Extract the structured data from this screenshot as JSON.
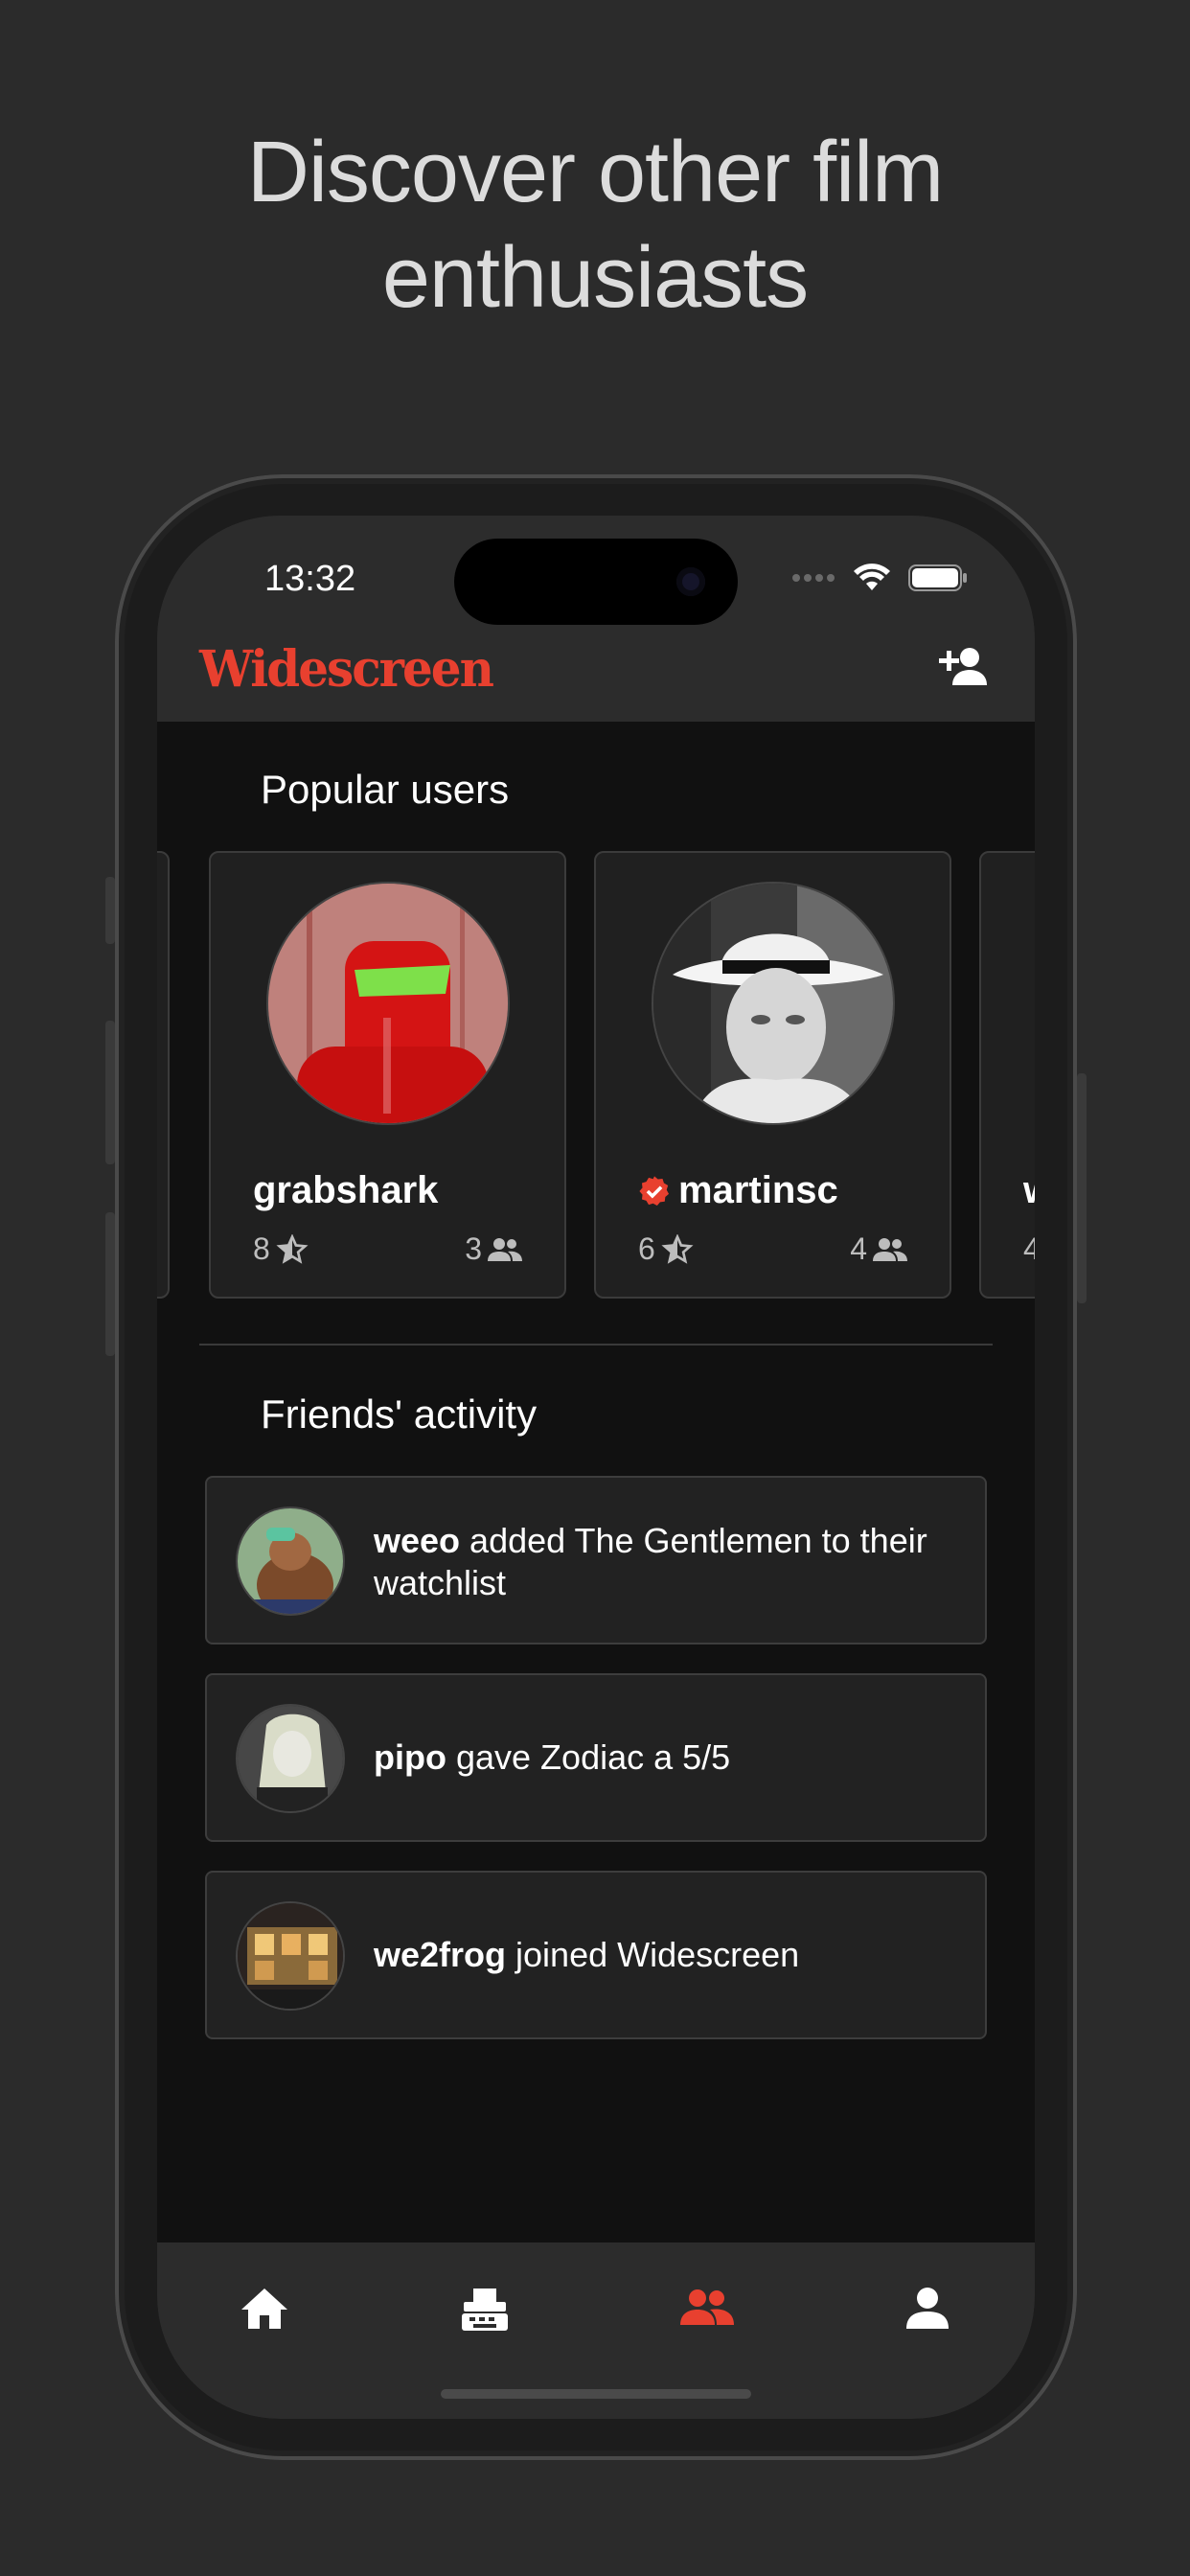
{
  "headline": {
    "line1": "Discover other film",
    "line2": "enthusiasts"
  },
  "status_bar": {
    "time": "13:32"
  },
  "app": {
    "brand": "Widescreen"
  },
  "popular": {
    "title": "Popular users",
    "users": [
      {
        "name": "grabshark",
        "ratings": "8",
        "friends": "3",
        "verified": false
      },
      {
        "name": "martinsc",
        "ratings": "6",
        "friends": "4",
        "verified": true
      }
    ],
    "peek_next": {
      "name_initial": "w",
      "ratings": "4"
    }
  },
  "activity": {
    "title": "Friends' activity",
    "items": [
      {
        "user": "weeo",
        "text": " added The Gentlemen to their watchlist"
      },
      {
        "user": "pipo",
        "text": " gave Zodiac a 5/5"
      },
      {
        "user": "we2frog",
        "text": " joined Widescreen"
      }
    ]
  },
  "colors": {
    "accent": "#e8402f",
    "background": "#2b2b2b",
    "screen_bg": "#111111",
    "bar_bg": "#2c2c2c"
  },
  "tabs": [
    {
      "icon": "home-icon",
      "active": false
    },
    {
      "icon": "typewriter-icon",
      "active": false
    },
    {
      "icon": "people-icon",
      "active": true
    },
    {
      "icon": "person-icon",
      "active": false
    }
  ]
}
